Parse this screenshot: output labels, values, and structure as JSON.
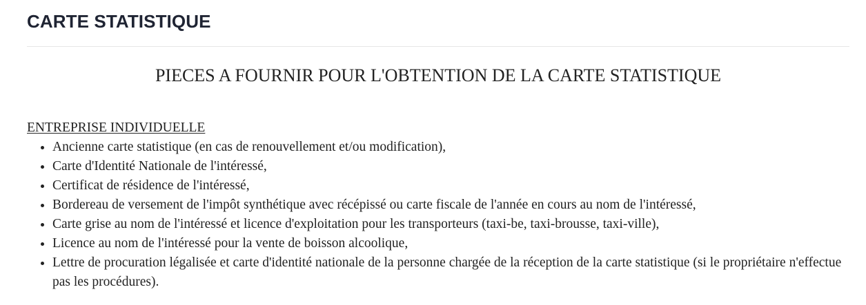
{
  "header": {
    "title": "CARTE STATISTIQUE"
  },
  "content": {
    "subtitle": "PIECES A FOURNIR POUR L'OBTENTION DE LA CARTE STATISTIQUE",
    "section": {
      "heading": "ENTREPRISE INDIVIDUELLE",
      "items": [
        "Ancienne carte statistique (en cas de renouvellement et/ou modification),",
        "Carte d'Identité Nationale de l'intéressé,",
        "Certificat de résidence de l'intéressé,",
        "Bordereau de versement de l'impôt synthétique avec récépissé ou carte fiscale de l'année en cours au nom de l'intéressé,",
        "Carte grise au nom de l'intéressé et licence d'exploitation pour les transporteurs (taxi-be, taxi-brousse, taxi-ville),",
        "Licence au nom de l'intéressé pour la vente de boisson alcoolique,",
        "Lettre de procuration légalisée et carte d'identité nationale de la personne chargée de la réception de la carte statistique (si le propriétaire n'effectue pas les procédures)."
      ]
    }
  }
}
